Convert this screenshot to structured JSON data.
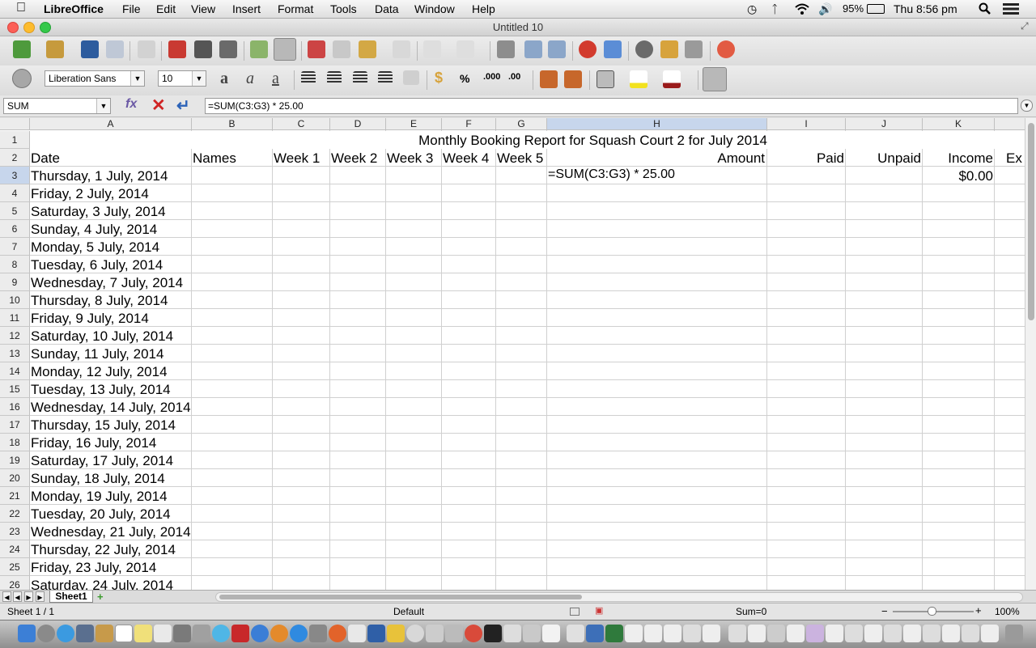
{
  "menubar": {
    "app_name": "LibreOffice",
    "items": [
      "File",
      "Edit",
      "View",
      "Insert",
      "Format",
      "Tools",
      "Data",
      "Window",
      "Help"
    ],
    "battery": "95%",
    "clock": "Thu 8:56 pm"
  },
  "window": {
    "title": "Untitled 10"
  },
  "format_toolbar": {
    "font_name": "Liberation Sans",
    "font_size": "10"
  },
  "formula_bar": {
    "name_box": "SUM",
    "formula": "=SUM(C3:G3) * 25.00"
  },
  "columns": [
    "A",
    "B",
    "C",
    "D",
    "E",
    "F",
    "G",
    "H",
    "I",
    "J",
    "K"
  ],
  "selected_column": "H",
  "selected_row": "3",
  "rows": [
    "1",
    "2",
    "3",
    "4",
    "5",
    "6",
    "7",
    "8",
    "9",
    "10",
    "11",
    "12",
    "13",
    "14",
    "15",
    "16",
    "17",
    "18",
    "19",
    "20",
    "21",
    "22",
    "23",
    "24",
    "25",
    "26"
  ],
  "sheet": {
    "title": "Monthly Booking Report for Squash Court 2 for July 2014",
    "headers": {
      "date": "Date",
      "names": "Names",
      "week1": "Week 1",
      "week2": "Week 2",
      "week3": "Week 3",
      "week4": "Week 4",
      "week5": "Week 5",
      "amount": "Amount",
      "paid": "Paid",
      "unpaid": "Unpaid",
      "income": "Income",
      "expenses_partial": "Ex"
    },
    "editing_cell_text": "=SUM(C3:G3) * 25.00",
    "income_value": "$0.00",
    "dates": [
      "Thursday, 1 July, 2014",
      "Friday, 2 July, 2014",
      "Saturday, 3 July, 2014",
      "Sunday, 4 July, 2014",
      "Monday, 5 July, 2014",
      "Tuesday, 6 July, 2014",
      "Wednesday, 7 July, 2014",
      "Thursday, 8 July, 2014",
      "Friday, 9 July, 2014",
      "Saturday, 10 July, 2014",
      "Sunday, 11 July, 2014",
      "Monday, 12 July, 2014",
      "Tuesday, 13 July, 2014",
      "Wednesday, 14 July, 2014",
      "Thursday, 15 July, 2014",
      "Friday, 16 July, 2014",
      "Saturday, 17 July, 2014",
      "Sunday, 18 July, 2014",
      "Monday, 19 July, 2014",
      "Tuesday, 20 July, 2014",
      "Wednesday, 21 July, 2014",
      "Thursday, 22 July, 2014",
      "Friday, 23 July, 2014",
      "Saturday, 24 July, 2014"
    ]
  },
  "tabs": {
    "sheet_name": "Sheet1"
  },
  "statusbar": {
    "sheet_pos": "Sheet 1 / 1",
    "page_style": "Default",
    "sum": "Sum=0",
    "zoom": "100%"
  },
  "colors": {
    "selection": "#c7d6ec",
    "grid": "#d0d0d0",
    "close": "#fc5f57",
    "minimize": "#fdbc2e",
    "zoom": "#34c84a"
  }
}
